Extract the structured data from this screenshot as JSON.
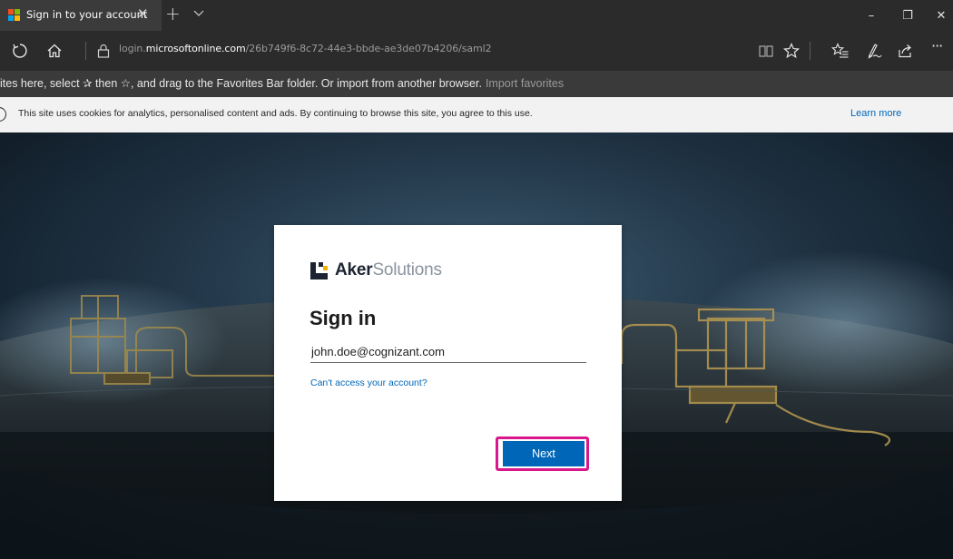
{
  "browser": {
    "tab": {
      "title": "Sign in to your account",
      "close_glyph": "✕",
      "icon": "microsoft-logo-icon"
    },
    "new_tab_glyph": "+",
    "window_controls": {
      "minimize": "–",
      "restore": "❐",
      "close": "✕"
    },
    "address": {
      "prefix": "login.",
      "host": "microsoftonline.com",
      "path": "/26b749f6-8c72-44e3-bbde-ae3de07b4206/saml2"
    },
    "toolbar_icons": [
      "refresh-icon",
      "home-icon",
      "lock-icon",
      "reading-view-icon",
      "favorite-star-icon",
      "favorites-list-icon",
      "pen-icon",
      "share-icon",
      "more-icon"
    ],
    "more_glyph": "···",
    "favorites_hint": {
      "text": "ites here, select ✰ then ☆, and drag to the Favorites Bar folder. Or import from another browser.",
      "link": "Import favorites"
    }
  },
  "cookie_banner": {
    "text": "This site uses cookies for analytics, personalised content and ads. By continuing to browse this site, you agree to this use.",
    "learn_more": "Learn more"
  },
  "signin": {
    "brand_bold": "Aker",
    "brand_light": "Solutions",
    "title": "Sign in",
    "email_value": "john.doe@cognizant.com",
    "cant_access": "Can't access your account?",
    "next_label": "Next"
  },
  "colors": {
    "accent": "#0067b8",
    "highlight": "#d9168c",
    "browser_chrome": "#2b2b2b"
  }
}
